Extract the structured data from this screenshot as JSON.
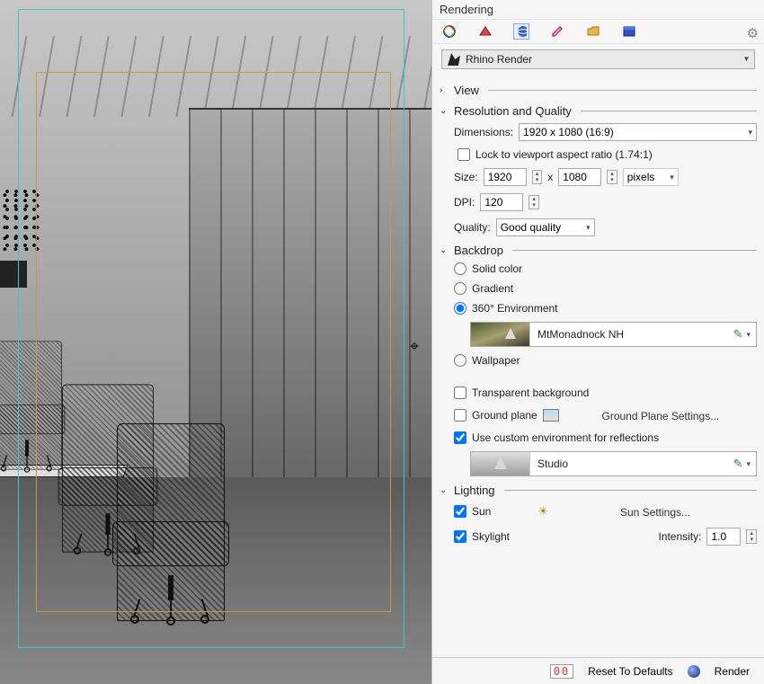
{
  "panel_title": "Rendering",
  "renderer": "Rhino Render",
  "sections": {
    "view": {
      "title": "View",
      "expanded": false
    },
    "resq": {
      "title": "Resolution and Quality",
      "expanded": true
    },
    "backdrop": {
      "title": "Backdrop",
      "expanded": true
    },
    "lighting": {
      "title": "Lighting",
      "expanded": true
    }
  },
  "resq": {
    "dimensions_label": "Dimensions:",
    "dimensions_value": "1920 x 1080 (16:9)",
    "lock_aspect_label": "Lock to viewport aspect ratio (1.74:1)",
    "lock_aspect_checked": false,
    "size_label": "Size:",
    "size_w": "1920",
    "size_sep": "x",
    "size_h": "1080",
    "size_units": "pixels",
    "dpi_label": "DPI:",
    "dpi_value": "120",
    "quality_label": "Quality:",
    "quality_value": "Good quality"
  },
  "backdrop": {
    "solid_label": "Solid color",
    "gradient_label": "Gradient",
    "env_label": "360° Environment",
    "env_name": "MtMonadnock NH",
    "wallpaper_label": "Wallpaper",
    "selected": "env",
    "transparent_label": "Transparent background",
    "transparent_checked": false,
    "groundplane_label": "Ground plane",
    "groundplane_checked": false,
    "groundplane_settings": "Ground Plane Settings...",
    "custom_refl_label": "Use custom environment for reflections",
    "custom_refl_checked": true,
    "refl_env_name": "Studio"
  },
  "lighting": {
    "sun_label": "Sun",
    "sun_checked": true,
    "sun_settings": "Sun Settings...",
    "sky_label": "Skylight",
    "sky_checked": true,
    "intensity_label": "Intensity:",
    "intensity_value": "1.0"
  },
  "footer": {
    "counter": "00",
    "reset": "Reset To Defaults",
    "render": "Render"
  }
}
